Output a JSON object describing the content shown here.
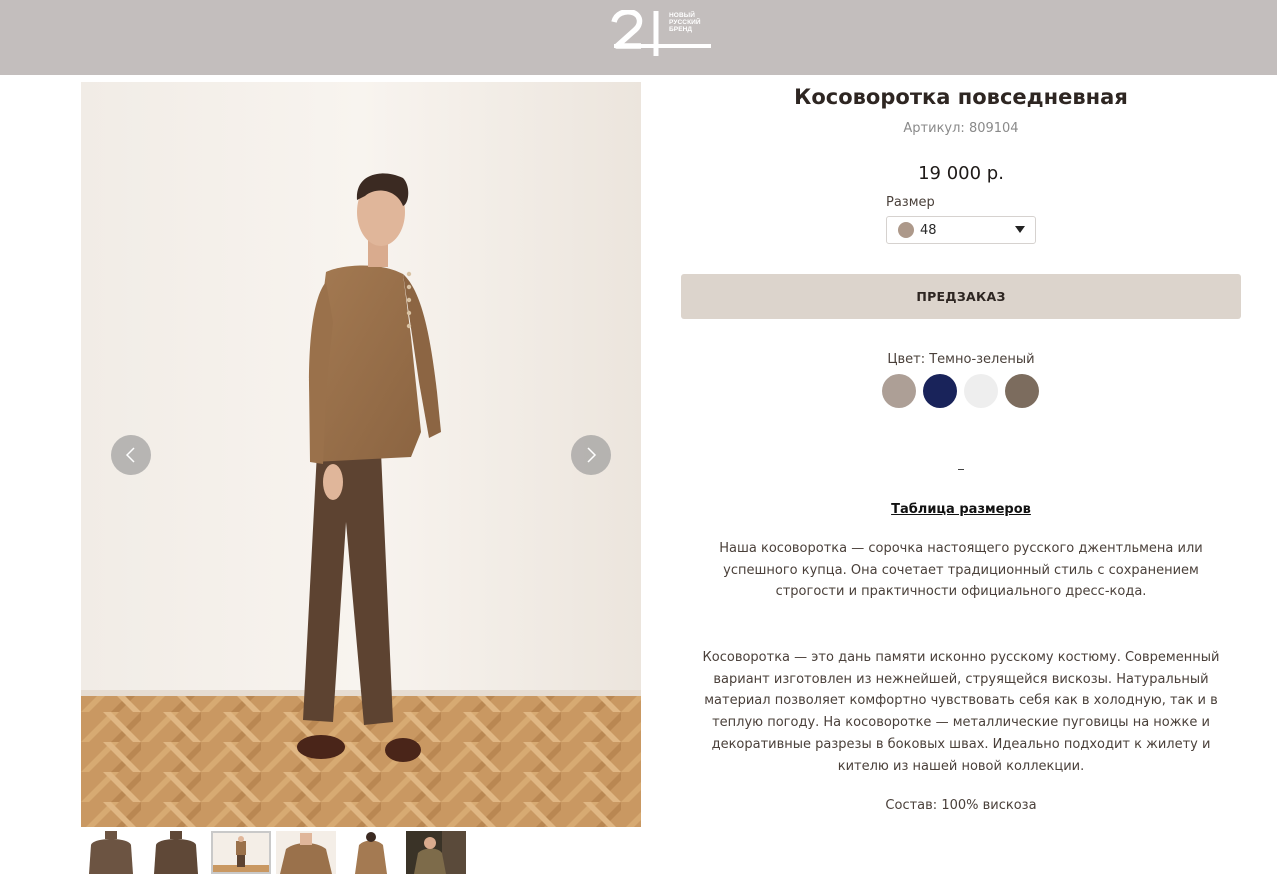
{
  "header": {
    "logo_number": "21",
    "logo_lines": [
      "НОВЫЙ",
      "РУССКИЙ",
      "БРЕНД"
    ]
  },
  "gallery": {
    "prev_icon": "chevron-left-icon",
    "next_icon": "chevron-right-icon",
    "thumbnail_count": 6,
    "active_thumbnail": 3
  },
  "product": {
    "title": "Косоворотка повседневная",
    "sku": "Артикул: 809104",
    "price": "19 000 р.",
    "size_label": "Размер",
    "size_value": "48",
    "size_swatch_color": "#ad998a",
    "preorder_label": "ПРЕДЗАКАЗ",
    "color_label": "Цвет: Темно-зеленый",
    "colors": [
      "#ad9f96",
      "#19235a",
      "#eeeeee",
      "#7c6c5e"
    ],
    "dash": "-",
    "size_table_link": "Таблица размеров",
    "description_1": "Наша косоворотка — сорочка настоящего русского джентльмена или успешного купца. Она сочетает традиционный стиль с сохранением строгости и практичности официального дресс-кода.",
    "description_2": "Косоворотка — это дань памяти исконно русскому костюму. Современный вариант изготовлен из нежнейшей, струящейся вискозы. Натуральный материал позволяет комфортно чувствовать себя как в холодную, так и в теплую погоду. На косоворотке — металлические пуговицы на ножке и декоративные разрезы в боковых швах. Идеально подходит к жилету и кителю из нашей новой коллекции.",
    "composition": "Состав: 100% вискоза"
  },
  "colors": {
    "header_bg": "#c3bebd",
    "button_bg": "#dcd4cc"
  }
}
